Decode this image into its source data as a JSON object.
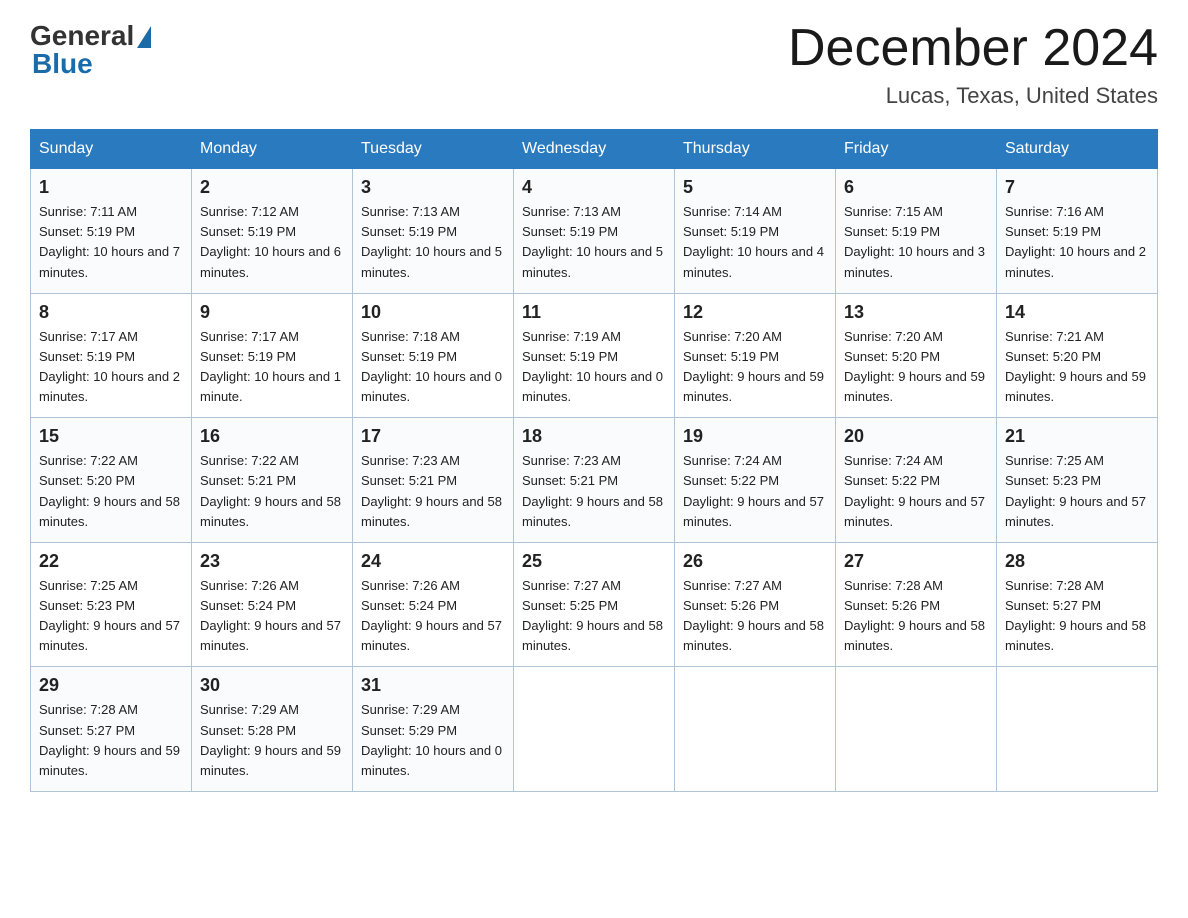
{
  "header": {
    "logo_general": "General",
    "logo_blue": "Blue",
    "month_title": "December 2024",
    "location": "Lucas, Texas, United States"
  },
  "weekdays": [
    "Sunday",
    "Monday",
    "Tuesday",
    "Wednesday",
    "Thursday",
    "Friday",
    "Saturday"
  ],
  "weeks": [
    [
      {
        "day": "1",
        "sunrise": "7:11 AM",
        "sunset": "5:19 PM",
        "daylight": "10 hours and 7 minutes."
      },
      {
        "day": "2",
        "sunrise": "7:12 AM",
        "sunset": "5:19 PM",
        "daylight": "10 hours and 6 minutes."
      },
      {
        "day": "3",
        "sunrise": "7:13 AM",
        "sunset": "5:19 PM",
        "daylight": "10 hours and 5 minutes."
      },
      {
        "day": "4",
        "sunrise": "7:13 AM",
        "sunset": "5:19 PM",
        "daylight": "10 hours and 5 minutes."
      },
      {
        "day": "5",
        "sunrise": "7:14 AM",
        "sunset": "5:19 PM",
        "daylight": "10 hours and 4 minutes."
      },
      {
        "day": "6",
        "sunrise": "7:15 AM",
        "sunset": "5:19 PM",
        "daylight": "10 hours and 3 minutes."
      },
      {
        "day": "7",
        "sunrise": "7:16 AM",
        "sunset": "5:19 PM",
        "daylight": "10 hours and 2 minutes."
      }
    ],
    [
      {
        "day": "8",
        "sunrise": "7:17 AM",
        "sunset": "5:19 PM",
        "daylight": "10 hours and 2 minutes."
      },
      {
        "day": "9",
        "sunrise": "7:17 AM",
        "sunset": "5:19 PM",
        "daylight": "10 hours and 1 minute."
      },
      {
        "day": "10",
        "sunrise": "7:18 AM",
        "sunset": "5:19 PM",
        "daylight": "10 hours and 0 minutes."
      },
      {
        "day": "11",
        "sunrise": "7:19 AM",
        "sunset": "5:19 PM",
        "daylight": "10 hours and 0 minutes."
      },
      {
        "day": "12",
        "sunrise": "7:20 AM",
        "sunset": "5:19 PM",
        "daylight": "9 hours and 59 minutes."
      },
      {
        "day": "13",
        "sunrise": "7:20 AM",
        "sunset": "5:20 PM",
        "daylight": "9 hours and 59 minutes."
      },
      {
        "day": "14",
        "sunrise": "7:21 AM",
        "sunset": "5:20 PM",
        "daylight": "9 hours and 59 minutes."
      }
    ],
    [
      {
        "day": "15",
        "sunrise": "7:22 AM",
        "sunset": "5:20 PM",
        "daylight": "9 hours and 58 minutes."
      },
      {
        "day": "16",
        "sunrise": "7:22 AM",
        "sunset": "5:21 PM",
        "daylight": "9 hours and 58 minutes."
      },
      {
        "day": "17",
        "sunrise": "7:23 AM",
        "sunset": "5:21 PM",
        "daylight": "9 hours and 58 minutes."
      },
      {
        "day": "18",
        "sunrise": "7:23 AM",
        "sunset": "5:21 PM",
        "daylight": "9 hours and 58 minutes."
      },
      {
        "day": "19",
        "sunrise": "7:24 AM",
        "sunset": "5:22 PM",
        "daylight": "9 hours and 57 minutes."
      },
      {
        "day": "20",
        "sunrise": "7:24 AM",
        "sunset": "5:22 PM",
        "daylight": "9 hours and 57 minutes."
      },
      {
        "day": "21",
        "sunrise": "7:25 AM",
        "sunset": "5:23 PM",
        "daylight": "9 hours and 57 minutes."
      }
    ],
    [
      {
        "day": "22",
        "sunrise": "7:25 AM",
        "sunset": "5:23 PM",
        "daylight": "9 hours and 57 minutes."
      },
      {
        "day": "23",
        "sunrise": "7:26 AM",
        "sunset": "5:24 PM",
        "daylight": "9 hours and 57 minutes."
      },
      {
        "day": "24",
        "sunrise": "7:26 AM",
        "sunset": "5:24 PM",
        "daylight": "9 hours and 57 minutes."
      },
      {
        "day": "25",
        "sunrise": "7:27 AM",
        "sunset": "5:25 PM",
        "daylight": "9 hours and 58 minutes."
      },
      {
        "day": "26",
        "sunrise": "7:27 AM",
        "sunset": "5:26 PM",
        "daylight": "9 hours and 58 minutes."
      },
      {
        "day": "27",
        "sunrise": "7:28 AM",
        "sunset": "5:26 PM",
        "daylight": "9 hours and 58 minutes."
      },
      {
        "day": "28",
        "sunrise": "7:28 AM",
        "sunset": "5:27 PM",
        "daylight": "9 hours and 58 minutes."
      }
    ],
    [
      {
        "day": "29",
        "sunrise": "7:28 AM",
        "sunset": "5:27 PM",
        "daylight": "9 hours and 59 minutes."
      },
      {
        "day": "30",
        "sunrise": "7:29 AM",
        "sunset": "5:28 PM",
        "daylight": "9 hours and 59 minutes."
      },
      {
        "day": "31",
        "sunrise": "7:29 AM",
        "sunset": "5:29 PM",
        "daylight": "10 hours and 0 minutes."
      },
      null,
      null,
      null,
      null
    ]
  ],
  "labels": {
    "sunrise_prefix": "Sunrise: ",
    "sunset_prefix": "Sunset: ",
    "daylight_prefix": "Daylight: "
  }
}
